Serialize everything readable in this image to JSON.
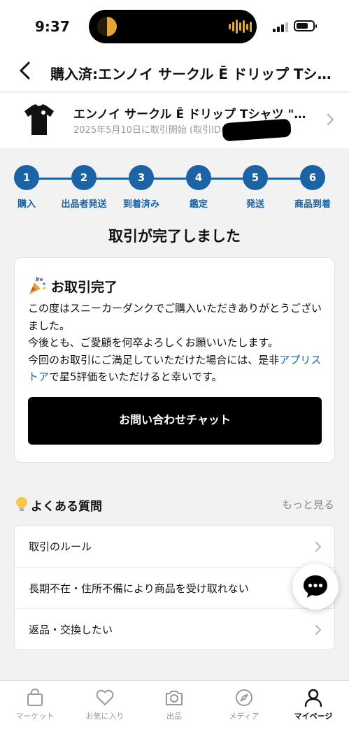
{
  "status_bar": {
    "time": "9:37"
  },
  "header": {
    "title": "購入済:エンノイ サークル Ē ドリップ Tシャツ \"ブラック\"",
    "back_icon": "back-arrow-icon"
  },
  "product": {
    "name": "エンノイ サークル Ē ドリップ Tシャツ \"ブラック\"",
    "subtitle": "2025年5月10日に取引開始 (取引ID"
  },
  "progress": {
    "steps": [
      {
        "num": "1",
        "label": "購入"
      },
      {
        "num": "2",
        "label": "出品者発送"
      },
      {
        "num": "3",
        "label": "到着済み"
      },
      {
        "num": "4",
        "label": "鑑定"
      },
      {
        "num": "5",
        "label": "発送"
      },
      {
        "num": "6",
        "label": "商品到着"
      }
    ],
    "completed_fraction": 1.0
  },
  "completion_title": "取引が完了しました",
  "card": {
    "icon": "party-popper-icon",
    "title": "お取引完了",
    "line1": "この度はスニーカーダンクでご購入いただきありがとうございました。",
    "line2": "今後とも、ご愛顧を何卒よろしくお願いいたします。",
    "line3_pre": "今回のお取引にご満足していただけた場合には、是非",
    "line3_link": "アプリストア",
    "line3_post": "で星5評価をいただけると幸いです。",
    "button_label": "お問い合わせチャット"
  },
  "faq": {
    "icon": "lightbulb-icon",
    "title": "よくある質問",
    "more_label": "もっと見る",
    "items": [
      "取引のルール",
      "長期不在・住所不備により商品を受け取れない",
      "返品・交換したい"
    ]
  },
  "fab": {
    "icon": "chat-bubble-icon"
  },
  "tabbar": {
    "items": [
      {
        "label": "マーケット",
        "icon": "shopping-bag-icon"
      },
      {
        "label": "お気に入り",
        "icon": "heart-icon"
      },
      {
        "label": "出品",
        "icon": "camera-icon"
      },
      {
        "label": "メディア",
        "icon": "compass-icon"
      },
      {
        "label": "マイページ",
        "icon": "user-icon"
      }
    ],
    "active_index": 4
  },
  "colors": {
    "accent": "#1b63a5",
    "button": "#000000",
    "background": "#f2f2f2"
  }
}
